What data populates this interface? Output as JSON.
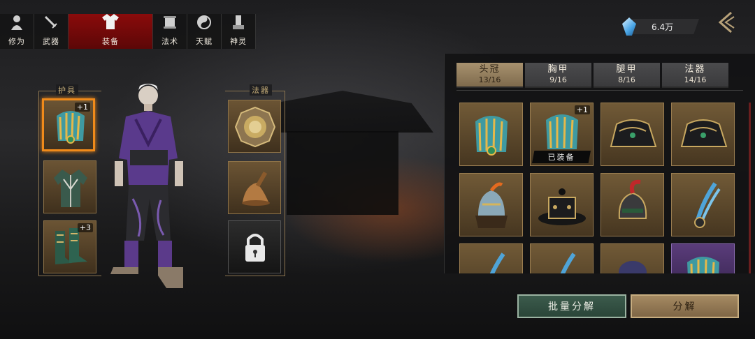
{
  "tabs": [
    {
      "label": "修为",
      "icon": "cultivation-figure-icon",
      "active": false
    },
    {
      "label": "武器",
      "icon": "sword-icon",
      "active": false
    },
    {
      "label": "装备",
      "icon": "robe-icon",
      "active": true
    },
    {
      "label": "法术",
      "icon": "scroll-icon",
      "active": false
    },
    {
      "label": "天赋",
      "icon": "yin-yang-icon",
      "active": false
    },
    {
      "label": "神灵",
      "icon": "shrine-icon",
      "active": false
    }
  ],
  "currency": {
    "amount": "6.4万",
    "icon": "crystal-icon"
  },
  "left_panel": {
    "armor_label": "护具",
    "artifact_label": "法器",
    "armor_slots": [
      {
        "icon": "crown-icon",
        "plus": "+1",
        "selected": true
      },
      {
        "icon": "robe-armor-icon",
        "plus": "",
        "selected": false
      },
      {
        "icon": "boots-icon",
        "plus": "+3",
        "selected": false
      }
    ],
    "artifact_slots": [
      {
        "icon": "bagua-mirror-icon"
      },
      {
        "icon": "bell-icon"
      },
      {
        "icon": "lock-icon",
        "locked": true
      }
    ]
  },
  "categories": [
    {
      "name": "头冠",
      "count": "13/16",
      "active": true
    },
    {
      "name": "胸甲",
      "count": "9/16",
      "active": false
    },
    {
      "name": "腿甲",
      "count": "8/16",
      "active": false
    },
    {
      "name": "法器",
      "count": "14/16",
      "active": false
    }
  ],
  "inventory": [
    {
      "icon": "crown-icon",
      "plus": "",
      "equipped": false,
      "rarity": "gold"
    },
    {
      "icon": "crown-icon",
      "plus": "+1",
      "equipped": true,
      "rarity": "gold"
    },
    {
      "icon": "scholar-hat-icon",
      "plus": "",
      "equipped": false,
      "rarity": "gold"
    },
    {
      "icon": "scholar-hat-icon",
      "plus": "",
      "equipped": false,
      "rarity": "gold"
    },
    {
      "icon": "war-helmet-icon",
      "plus": "",
      "equipped": false,
      "rarity": "gold"
    },
    {
      "icon": "official-hat-icon",
      "plus": "",
      "equipped": false,
      "rarity": "gold"
    },
    {
      "icon": "plumed-helmet-icon",
      "plus": "",
      "equipped": false,
      "rarity": "gold"
    },
    {
      "icon": "feather-hairpin-icon",
      "plus": "",
      "equipped": false,
      "rarity": "gold"
    },
    {
      "icon": "feather-hairpin-icon",
      "plus": "",
      "equipped": false,
      "rarity": "gold"
    },
    {
      "icon": "feather-hairpin-icon",
      "plus": "",
      "equipped": false,
      "rarity": "gold"
    },
    {
      "icon": "hair-bun-icon",
      "plus": "",
      "equipped": false,
      "rarity": "gold"
    },
    {
      "icon": "crown-icon",
      "plus": "",
      "equipped": false,
      "rarity": "purple"
    }
  ],
  "equipped_label": "已装备",
  "buttons": {
    "batch_decompose": "批量分解",
    "decompose": "分解"
  }
}
